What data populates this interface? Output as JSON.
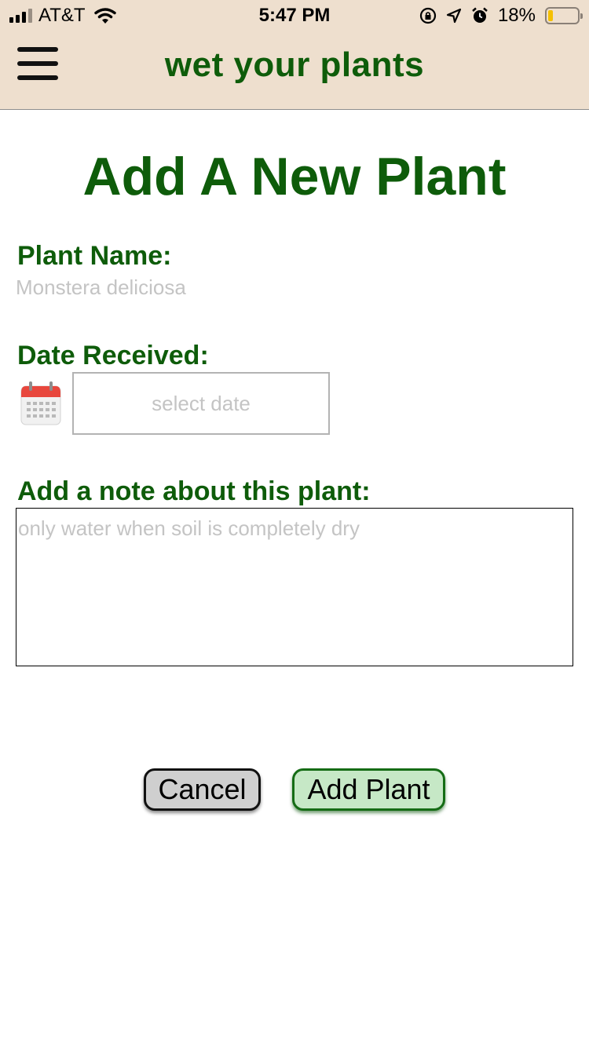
{
  "status_bar": {
    "carrier": "AT&T",
    "time": "5:47 PM",
    "battery_percent": "18%",
    "battery_level": 0.18,
    "icons": [
      "signal-icon",
      "wifi-icon",
      "rotation-lock-icon",
      "location-arrow-icon",
      "alarm-icon",
      "battery-icon"
    ]
  },
  "header": {
    "app_title": "wet your plants",
    "menu_icon": "hamburger-menu-icon"
  },
  "form": {
    "title": "Add A New Plant",
    "plant_name_label": "Plant Name:",
    "plant_name_placeholder": "Monstera deliciosa",
    "date_label": "Date Received:",
    "date_placeholder": "select date",
    "calendar_icon": "calendar-icon",
    "note_label": "Add a note about this plant:",
    "note_placeholder": "only water when soil is completely dry"
  },
  "buttons": {
    "cancel": "Cancel",
    "add_plant": "Add Plant"
  },
  "colors": {
    "brand_green": "#0e5c0a",
    "header_bg": "#eedfce",
    "add_button_bg": "#c6e8c6",
    "cancel_button_bg": "#cfcfcf",
    "battery_fill": "#f5c000"
  }
}
